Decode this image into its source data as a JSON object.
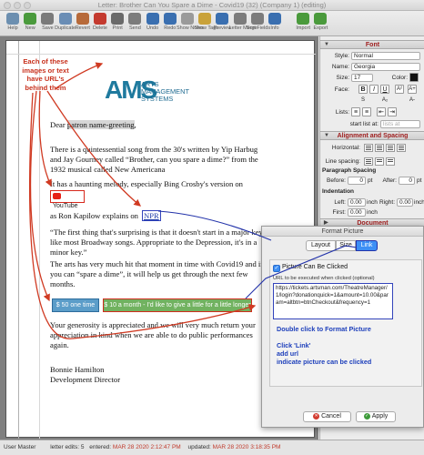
{
  "window": {
    "title": "Letter: Brother Can You Spare a Dime - Covid19 (32) (Company 1) (editing)"
  },
  "toolbar": [
    {
      "label": "Help",
      "icon": "help-icon",
      "color": "#6c8fb0"
    },
    {
      "label": "New",
      "icon": "new-icon",
      "color": "#4a9a3c"
    },
    {
      "label": "Save",
      "icon": "save-icon",
      "color": "#7a7a7a"
    },
    {
      "label": "Duplicate",
      "icon": "duplicate-icon",
      "color": "#6a8db5"
    },
    {
      "label": "Revert",
      "icon": "revert-icon",
      "color": "#b76a3a"
    },
    {
      "label": "Delete",
      "icon": "delete-icon",
      "color": "#c43a2f"
    },
    {
      "label": "Print",
      "icon": "print-icon",
      "color": "#6a6a6a"
    },
    {
      "label": "Send",
      "icon": "send-icon",
      "color": "#7c7c7c"
    },
    {
      "label": "Undo",
      "icon": "undo-icon",
      "color": "#3a6fb0"
    },
    {
      "label": "Redo",
      "icon": "redo-icon",
      "color": "#3a6fb0"
    },
    {
      "label": "Show Notes",
      "icon": "notes-icon",
      "color": "#9a9a9a"
    },
    {
      "label": "Show Tags",
      "icon": "tags-icon",
      "color": "#c9a23a"
    },
    {
      "label": "Preview",
      "icon": "preview-icon",
      "color": "#3a6fb0"
    },
    {
      "label": "Letter Merge",
      "icon": "merge-icon",
      "color": "#7c7c7c"
    },
    {
      "label": "Sort Fields",
      "icon": "sort-icon",
      "color": "#7c7c7c"
    },
    {
      "label": "Info",
      "icon": "info-icon",
      "color": "#3a6fb0"
    },
    {
      "label": "Import",
      "icon": "import-icon",
      "color": "#4a9a3c"
    },
    {
      "label": "Export",
      "icon": "export-icon",
      "color": "#4a9a3c"
    }
  ],
  "annotation": {
    "text": "Each of these images or text have URL's behind them"
  },
  "logo": {
    "mark": "AMS",
    "lines": [
      "ARTS",
      "MANAGEMENT",
      "SYSTEMS"
    ]
  },
  "letter": {
    "greeting_prefix": "Dear ",
    "greeting_field": "patron name-greeting",
    ",": ",",
    "p1": "There is a quintessential song from the 30's written by Yip Harbug and Jay Gourney called “Brother, can you spare a dime?” from the 1932 musical called New Americana",
    "p2": "It has a haunting melody, especially Bing Crosby's version on",
    "youtube": "YouTube",
    "p3_prefix": "as Ron Kapilow explains on ",
    "npr": "NPR",
    "p4": "“The first thing that's surprising is that it doesn't start in a major key like most Broadway songs.  Appropriate to the Depression, it's in a minor key.”",
    "p5": "The arts has very much hit that moment in time with Covid19 and if you can “spare a dime”, it will help us get through the next few months.",
    "donate_50": "$ 50 one time",
    "donate_10": "$ 10 a month - I'd like to give a little for a little longer",
    "p6": "Your generosity is appreciated and we will very much return your appreciation in kind when we are able to do public performances again.",
    "sig_name": "Bonnie Hamilton",
    "sig_title": "Development Director"
  },
  "sidebar": {
    "font_header": "Font",
    "style_label": "Style:",
    "style_value": "Normal",
    "name_label": "Name:",
    "name_value": "Georgia",
    "size_label": "Size:",
    "size_value": "17",
    "color_label": "Color:",
    "face_label": "Face:",
    "lists_label": "Lists:",
    "start_label": "start list at:",
    "start_placeholder": "lists at",
    "align_header": "Alignment and Spacing",
    "horizontal_label": "Horizontal:",
    "linespacing_label": "Line spacing:",
    "para_label": "Paragraph Spacing",
    "before_label": "Before:",
    "before_value": "0",
    "after_label": "After:",
    "after_value": "0",
    "pt": "pt",
    "indent_label": "Indentation",
    "left_label": "Left:",
    "left_value": "0.00",
    "right_label": "Right:",
    "right_value": "0.00",
    "first_label": "First:",
    "first_value": "0.00",
    "inch": "inch",
    "document_header": "Document"
  },
  "dialog": {
    "title": "Format Picture",
    "tab_layout": "Layout",
    "tab_size": "Size",
    "tab_link": "Link",
    "checkbox_label": "Picture Can Be Clicked",
    "url_label": "URL to be executed when clicked (optional)",
    "url_value": "https://tickets.artsman.com/TheatreManager/1/login?donationquick=1&amount=10.00&param=altbtn=btnCheckout&frequency=1",
    "instr1": "Double click to Format Picture",
    "instr2": "Click 'Link'",
    "instr3": "add url",
    "instr4": "indicate picture can be clicked",
    "cancel": "Cancel",
    "apply": "Apply"
  },
  "status": {
    "user": "User Master",
    "edits": "letter edits: 5",
    "entered_label": "entered:",
    "entered": "MAR 28 2020 2:12:47 PM",
    "updated_label": "updated:",
    "updated": "MAR 28 2020 3:18:35 PM"
  },
  "colors": {
    "accent": "#3d8ff5",
    "annotation": "#c8321e",
    "instruction": "#1d3fbb",
    "logo": "#1f7a9e"
  }
}
